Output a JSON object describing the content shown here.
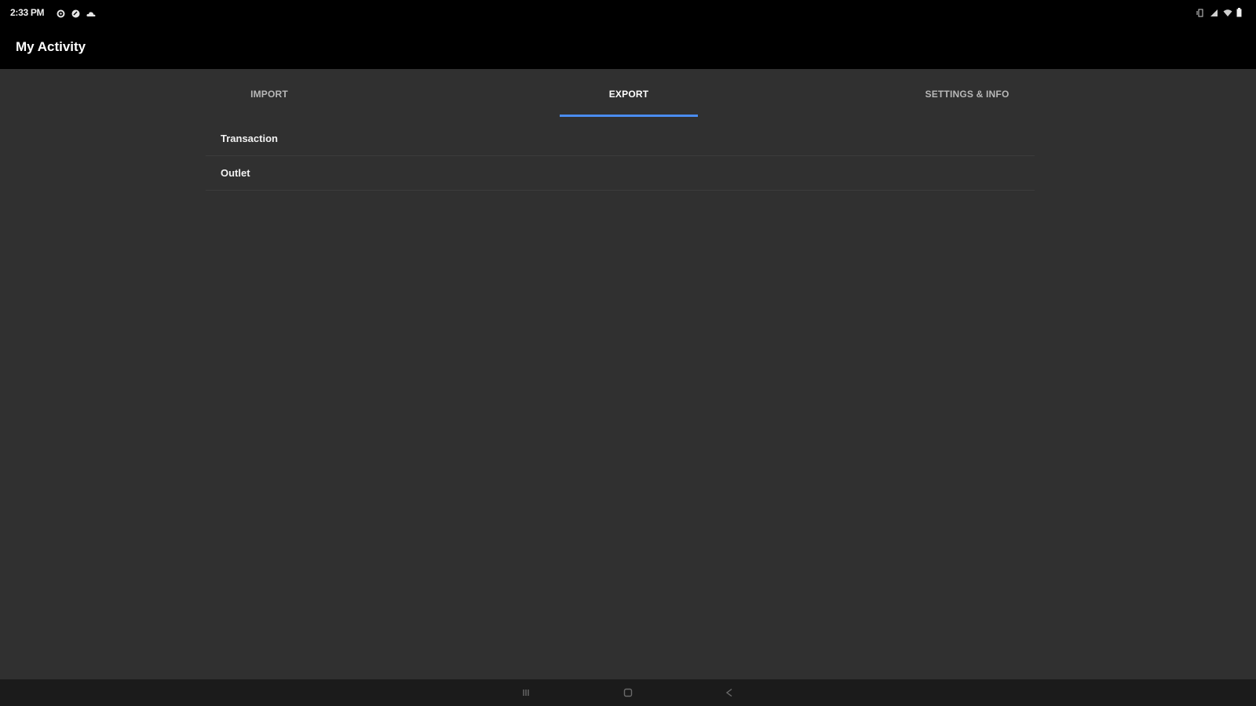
{
  "status_bar": {
    "time": "2:33 PM",
    "left_icons": [
      "settings-icon",
      "sync-icon",
      "cloud-icon"
    ],
    "right_icons": [
      "vibrate-icon",
      "signal-icon",
      "wifi-icon",
      "battery-icon"
    ]
  },
  "app_bar": {
    "title": "My Activity"
  },
  "tabs": [
    {
      "label": "IMPORT",
      "active": false
    },
    {
      "label": "EXPORT",
      "active": true
    },
    {
      "label": "SETTINGS & INFO",
      "active": false
    }
  ],
  "list": {
    "items": [
      {
        "label": "Transaction"
      },
      {
        "label": "Outlet"
      }
    ]
  },
  "nav_bar": {
    "buttons": [
      "recents-icon",
      "home-icon",
      "back-icon"
    ]
  },
  "colors": {
    "accent": "#4a8cf0",
    "background": "#303030",
    "bar": "#000000"
  }
}
